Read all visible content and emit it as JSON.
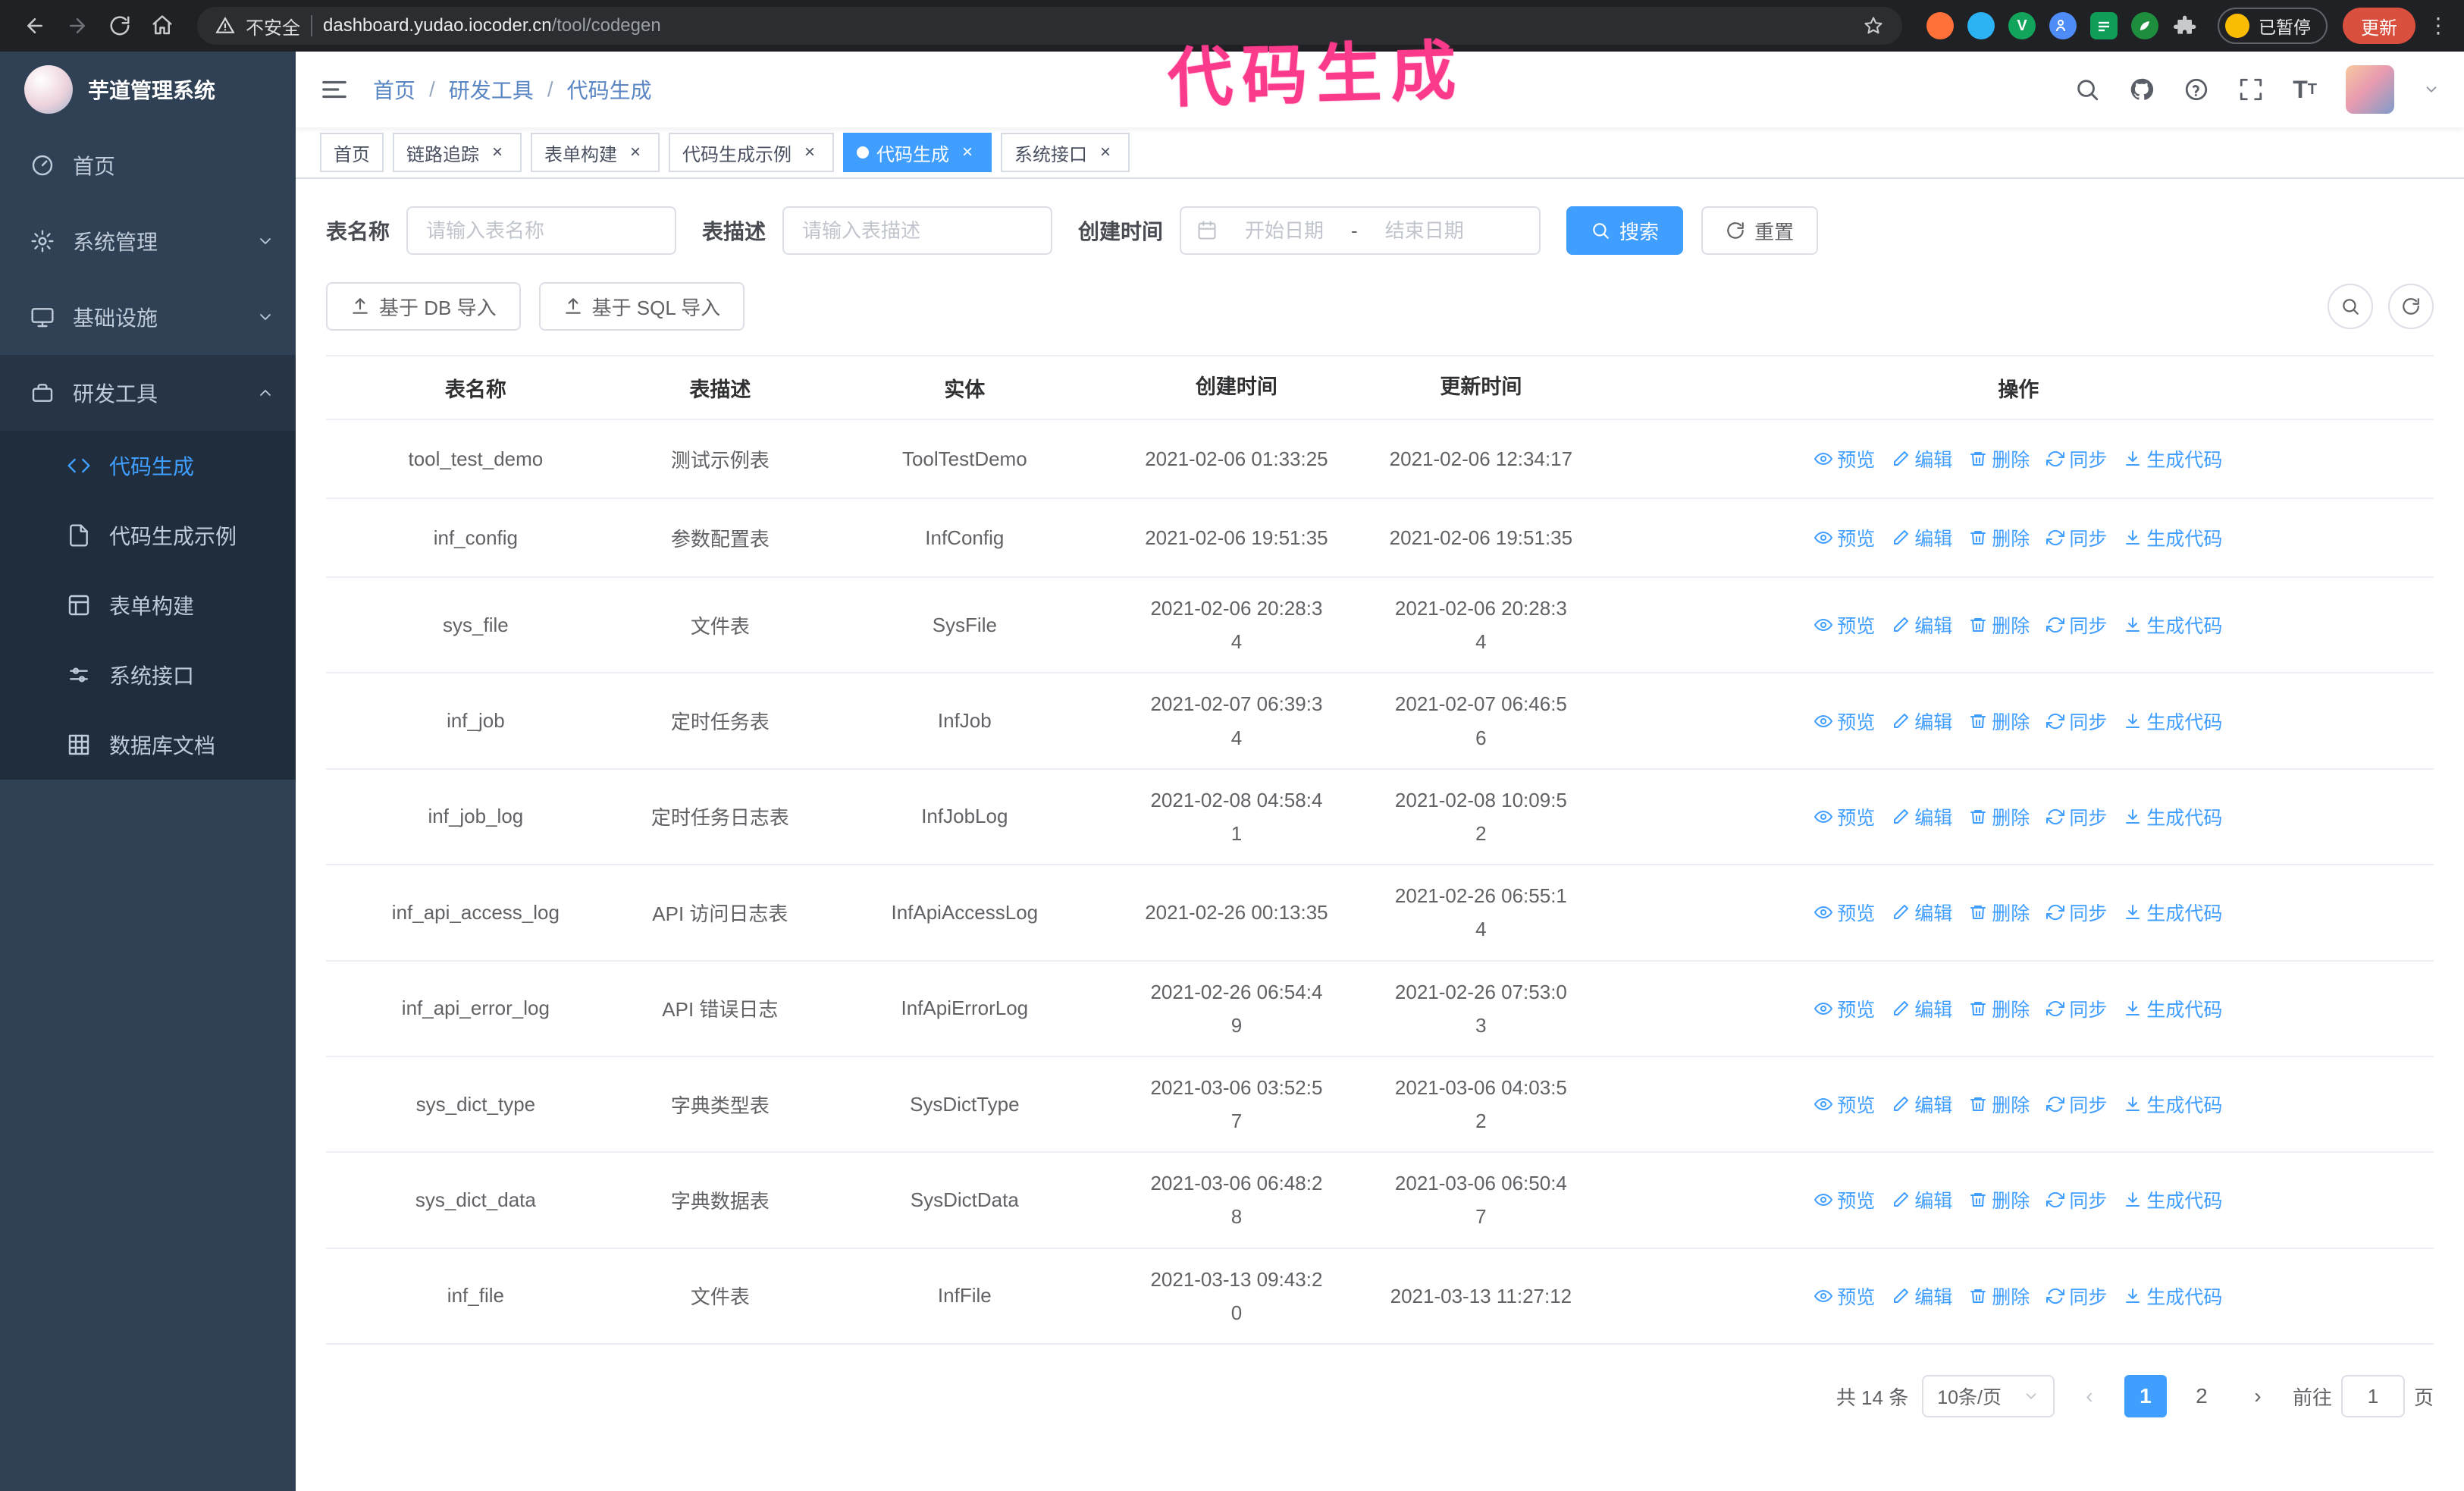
{
  "colors": {
    "accent": "#409EFF",
    "sidebar_bg": "#304156",
    "submenu_bg": "#1f2d3d",
    "annotation_pink": "#fb3a8c",
    "update_button": "#d9503f",
    "paused_face": "#fbbc04"
  },
  "annotation": {
    "text": "代码生成"
  },
  "browser": {
    "security_label": "不安全",
    "url_host": "dashboard.yudao.iocoder.cn",
    "url_path": "/tool/codegen",
    "paused_badge": "已暂停",
    "update_button": "更新",
    "nav_icons": [
      "back-icon",
      "forward-icon",
      "reload-icon",
      "home-icon",
      "star-icon"
    ],
    "extension_icons": [
      "fox-ext-icon",
      "drop-ext-icon",
      "v-ext-icon",
      "users-ext-icon",
      "bars-ext-icon",
      "leaf-ext-icon",
      "puzzle-ext-icon"
    ]
  },
  "sidebar": {
    "logo_title": "芋道管理系统",
    "items": [
      {
        "label": "首页",
        "icon": "dashboard-icon"
      },
      {
        "label": "系统管理",
        "icon": "gear-icon",
        "state": "collapsed"
      },
      {
        "label": "基础设施",
        "icon": "monitor-icon",
        "state": "collapsed"
      },
      {
        "label": "研发工具",
        "icon": "toolbox-icon",
        "state": "expanded"
      }
    ],
    "sub_items": [
      {
        "label": "代码生成",
        "icon": "code-icon",
        "active": true
      },
      {
        "label": "代码生成示例",
        "icon": "document-icon",
        "active": false
      },
      {
        "label": "表单构建",
        "icon": "form-grid-icon",
        "active": false
      },
      {
        "label": "系统接口",
        "icon": "sliders-icon",
        "active": false
      },
      {
        "label": "数据库文档",
        "icon": "table-grid-icon",
        "active": false
      }
    ]
  },
  "header": {
    "breadcrumb": [
      "首页",
      "研发工具",
      "代码生成"
    ],
    "right_icons": [
      "search-icon",
      "github-icon",
      "help-icon",
      "fullscreen-icon",
      "font-size-icon",
      "avatar",
      "caret-down-icon"
    ]
  },
  "tabs": [
    {
      "label": "首页",
      "closable": false,
      "active": false
    },
    {
      "label": "链路追踪",
      "closable": true,
      "active": false
    },
    {
      "label": "表单构建",
      "closable": true,
      "active": false
    },
    {
      "label": "代码生成示例",
      "closable": true,
      "active": false
    },
    {
      "label": "代码生成",
      "closable": true,
      "active": true
    },
    {
      "label": "系统接口",
      "closable": true,
      "active": false
    }
  ],
  "filters": {
    "table_name_label": "表名称",
    "table_name_placeholder": "请输入表名称",
    "table_desc_label": "表描述",
    "table_desc_placeholder": "请输入表描述",
    "create_time_label": "创建时间",
    "date_start_placeholder": "开始日期",
    "date_separator": "-",
    "date_end_placeholder": "结束日期",
    "search_button": "搜索",
    "reset_button": "重置"
  },
  "toolbar": {
    "import_db_button": "基于 DB 导入",
    "import_sql_button": "基于 SQL 导入",
    "mini_buttons": [
      "search-toggle-icon",
      "refresh-icon"
    ]
  },
  "table": {
    "columns": [
      "表名称",
      "表描述",
      "实体",
      "创建时间",
      "更新时间",
      "操作"
    ],
    "actions": [
      "预览",
      "编辑",
      "删除",
      "同步",
      "生成代码"
    ],
    "rows": [
      {
        "name": "tool_test_demo",
        "desc": "测试示例表",
        "entity": "ToolTestDemo",
        "created": "2021-02-06 01:33:25",
        "updated": "2021-02-06 12:34:17"
      },
      {
        "name": "inf_config",
        "desc": "参数配置表",
        "entity": "InfConfig",
        "created": "2021-02-06 19:51:35",
        "updated": "2021-02-06 19:51:35"
      },
      {
        "name": "sys_file",
        "desc": "文件表",
        "entity": "SysFile",
        "created": "2021-02-06 20:28:3\n4",
        "updated": "2021-02-06 20:28:3\n4"
      },
      {
        "name": "inf_job",
        "desc": "定时任务表",
        "entity": "InfJob",
        "created": "2021-02-07 06:39:3\n4",
        "updated": "2021-02-07 06:46:5\n6"
      },
      {
        "name": "inf_job_log",
        "desc": "定时任务日志表",
        "entity": "InfJobLog",
        "created": "2021-02-08 04:58:4\n1",
        "updated": "2021-02-08 10:09:5\n2"
      },
      {
        "name": "inf_api_access_log",
        "desc": "API 访问日志表",
        "entity": "InfApiAccessLog",
        "created": "2021-02-26 00:13:35",
        "updated": "2021-02-26 06:55:1\n4"
      },
      {
        "name": "inf_api_error_log",
        "desc": "API 错误日志",
        "entity": "InfApiErrorLog",
        "created": "2021-02-26 06:54:4\n9",
        "updated": "2021-02-26 07:53:0\n3"
      },
      {
        "name": "sys_dict_type",
        "desc": "字典类型表",
        "entity": "SysDictType",
        "created": "2021-03-06 03:52:5\n7",
        "updated": "2021-03-06 04:03:5\n2"
      },
      {
        "name": "sys_dict_data",
        "desc": "字典数据表",
        "entity": "SysDictData",
        "created": "2021-03-06 06:48:2\n8",
        "updated": "2021-03-06 06:50:4\n7"
      },
      {
        "name": "inf_file",
        "desc": "文件表",
        "entity": "InfFile",
        "created": "2021-03-13 09:43:2\n0",
        "updated": "2021-03-13 11:27:12"
      }
    ]
  },
  "pagination": {
    "total_text": "共 14 条",
    "page_size": "10条/页",
    "pages": [
      "1",
      "2"
    ],
    "active_page": "1",
    "goto_label": "前往",
    "goto_value": "1",
    "goto_suffix": "页"
  }
}
